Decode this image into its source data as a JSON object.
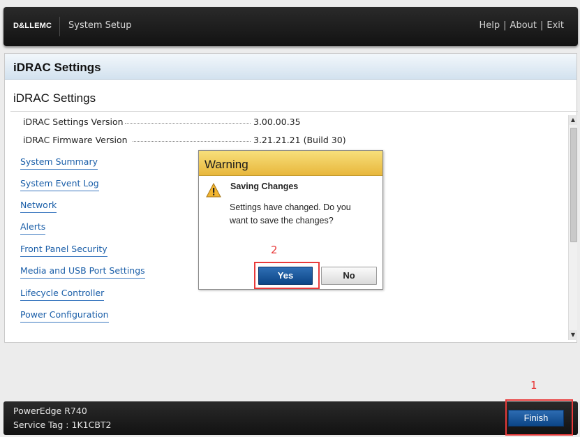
{
  "header": {
    "brand": "D&LLEMC",
    "app_title": "System Setup",
    "links": [
      "Help",
      "About",
      "Exit"
    ],
    "separator": "|"
  },
  "panel": {
    "title": "iDRAC Settings",
    "section_title": "iDRAC Settings",
    "info_rows": [
      {
        "label": "iDRAC Settings Version",
        "value": "3.00.00.35"
      },
      {
        "label": "iDRAC Firmware Version",
        "value": "3.21.21.21 (Build 30)"
      }
    ],
    "nav_links": [
      "System Summary",
      "System Event Log",
      "Network",
      "Alerts",
      "Front Panel Security",
      "Media and USB Port Settings",
      "Lifecycle Controller",
      "Power Configuration"
    ]
  },
  "dialog": {
    "title": "Warning",
    "subtitle": "Saving Changes",
    "message": "Settings have changed. Do you want to save the changes?",
    "yes_label": "Yes",
    "no_label": "No",
    "icon": "warning-triangle-icon",
    "header_color": "#f0c85a"
  },
  "annotations": {
    "step1": "1",
    "step2": "2",
    "color": "#e83a3a"
  },
  "footer": {
    "model": "PowerEdge R740",
    "service_tag": "Service Tag : 1K1CBT2",
    "finish_label": "Finish"
  },
  "colors": {
    "accent_blue": "#0c4586",
    "link_blue": "#1a5ea8"
  }
}
